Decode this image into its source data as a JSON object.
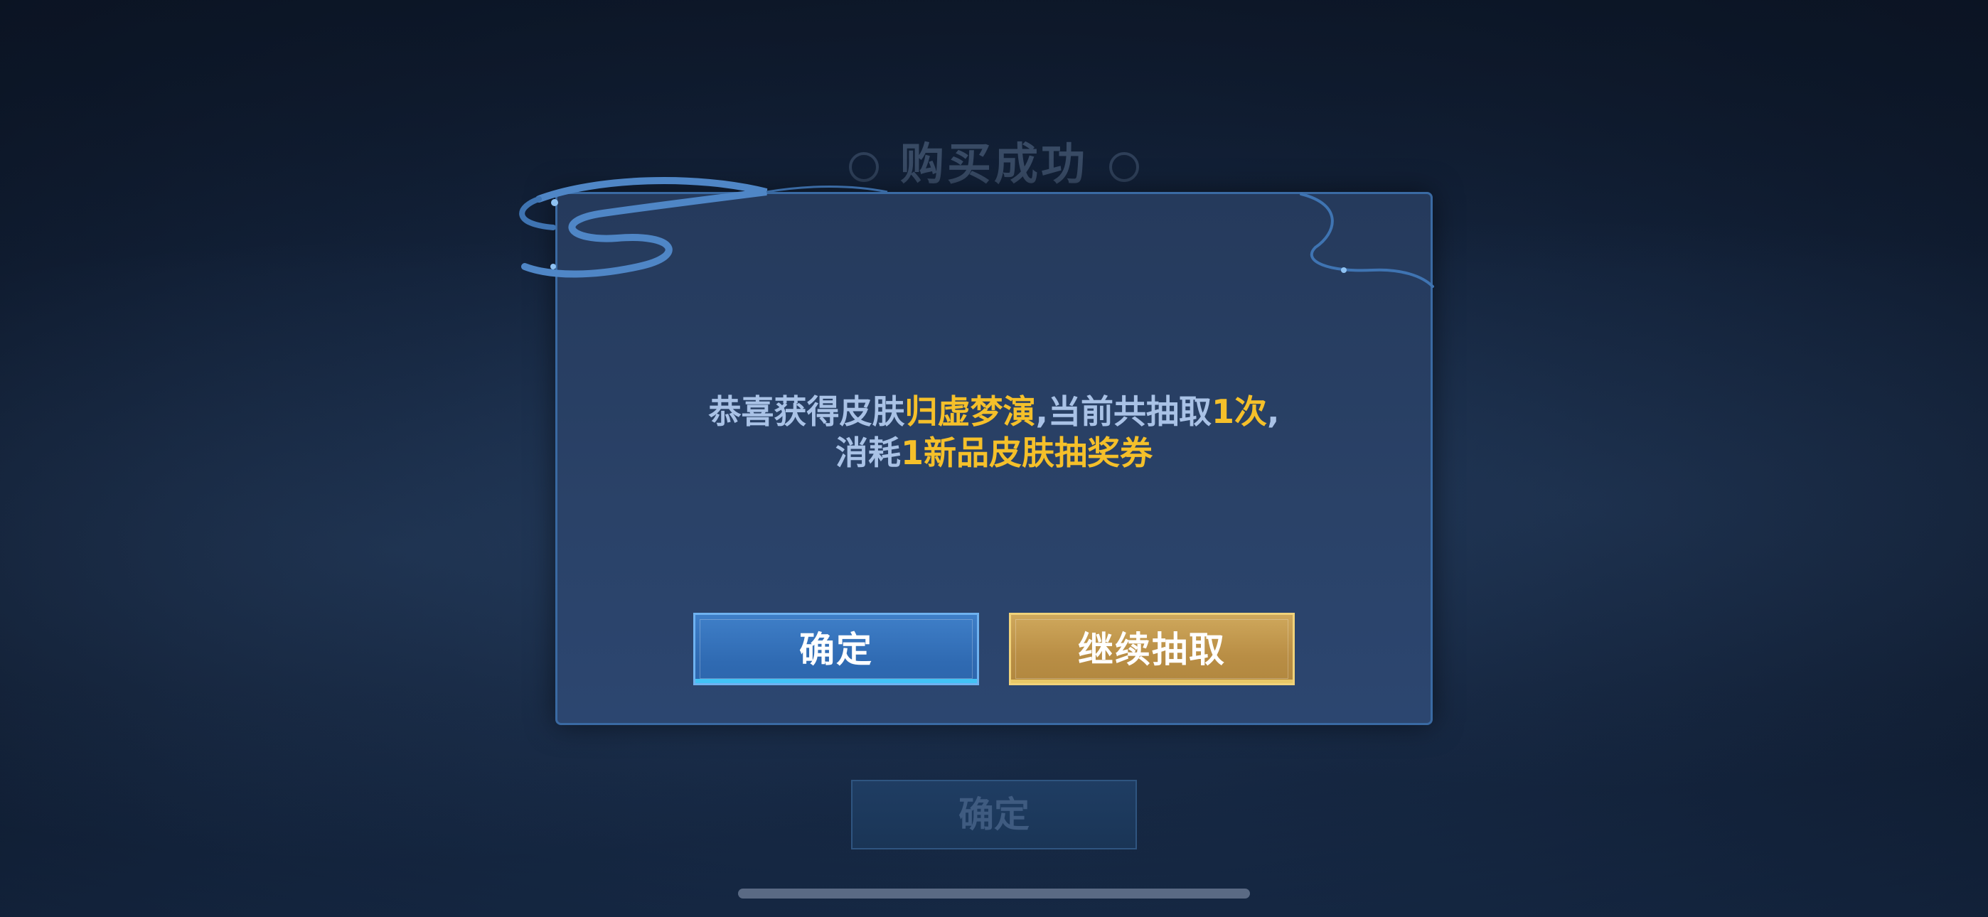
{
  "background": {
    "title": "购买成功",
    "button_label": "确定"
  },
  "dialog": {
    "message": {
      "line1": {
        "prefix": "恭喜获得皮肤",
        "skin_name": "归虚梦演",
        "middle": ",当前共抽取",
        "count": "1次",
        "suffix": ","
      },
      "line2": {
        "prefix": "消耗",
        "cost": "1新品皮肤抽奖券"
      }
    },
    "buttons": {
      "confirm_label": "确定",
      "continue_label": "继续抽取"
    }
  },
  "colors": {
    "highlight": "#f5c02a",
    "message_text": "#a9c2e6",
    "confirm_button": "#2f6ab2",
    "continue_button": "#b98e45"
  }
}
